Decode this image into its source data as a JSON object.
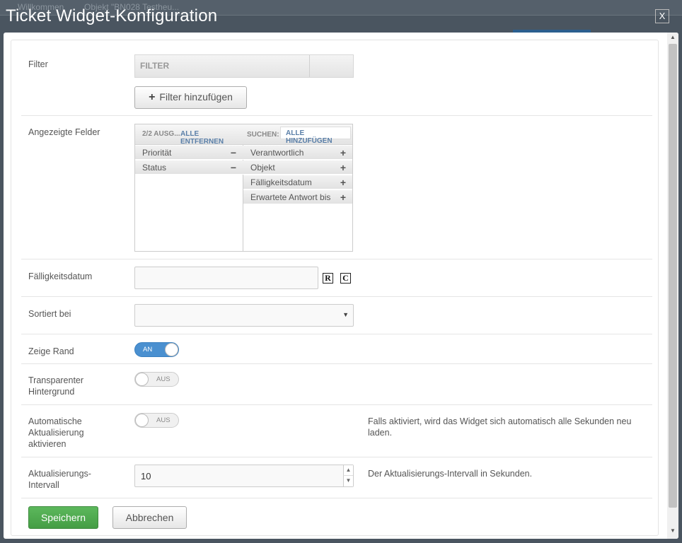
{
  "background": {
    "crumb_home": "Willkommen",
    "crumb_object": "Objekt \"BN028 Testheu..."
  },
  "dialog": {
    "title": "Ticket Widget-Konfiguration",
    "close_label": "X"
  },
  "filter": {
    "label": "Filter",
    "table_header": "FILTER",
    "add_button": "Filter hinzufügen",
    "add_icon": "+"
  },
  "fields": {
    "label": "Angezeigte Felder",
    "selected_count": "2/2 AUSG...",
    "remove_all": "ALLE ENTFERNEN",
    "search_label": "SUCHEN:",
    "add_all": "ALLE HINZUFÜGEN",
    "selected": [
      {
        "label": "Priorität"
      },
      {
        "label": "Status"
      }
    ],
    "available": [
      {
        "label": "Verantwortlich"
      },
      {
        "label": "Objekt"
      },
      {
        "label": "Fälligkeitsdatum"
      },
      {
        "label": "Erwartete Antwort bis"
      }
    ],
    "remove_icon": "−",
    "add_icon": "+"
  },
  "due_date": {
    "label": "Fälligkeitsdatum",
    "value": "",
    "icon_r": "R",
    "icon_c": "C"
  },
  "sort": {
    "label": "Sortiert bei",
    "value": "",
    "caret": "▼"
  },
  "show_border": {
    "label": "Zeige Rand",
    "state": "AN"
  },
  "transparent_bg": {
    "label": "Transparenter Hintergrund",
    "state": "AUS"
  },
  "auto_refresh": {
    "label": "Automatische Aktualisierung aktivieren",
    "state": "AUS",
    "help": "Falls aktiviert, wird das Widget sich automatisch alle Sekunden neu laden."
  },
  "refresh_interval": {
    "label": "Aktualisierungs-Intervall",
    "value": "10",
    "help": "Der Aktualisierungs-Intervall in Sekunden.",
    "spin_up": "▲",
    "spin_down": "▼"
  },
  "actions": {
    "save": "Speichern",
    "cancel": "Abbrechen"
  },
  "scrollbar": {
    "up": "▲",
    "down": "▼"
  },
  "colors": {
    "primary": "#5cb85c",
    "toggle_on": "#4a90d0",
    "link": "#5a7fa8"
  }
}
